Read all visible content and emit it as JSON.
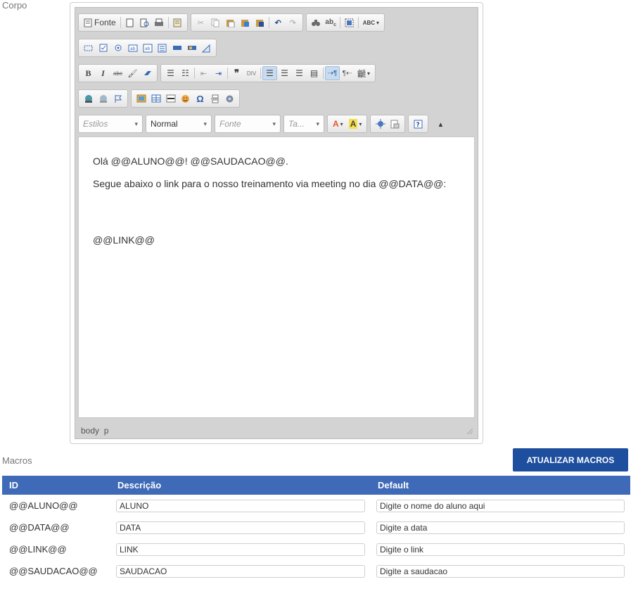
{
  "corpo_label": "Corpo",
  "toolbar": {
    "source_label": "Fonte",
    "spell_label": "ABC",
    "styles_placeholder": "Estilos",
    "format_value": "Normal",
    "font_placeholder": "Fonte",
    "size_placeholder": "Ta..."
  },
  "content": {
    "line1": "Olá @@ALUNO@@! @@SAUDACAO@@.",
    "line2": "Segue abaixo o link para o nosso treinamento via meeting no dia @@DATA@@:",
    "line3": "@@LINK@@"
  },
  "path": {
    "body": "body",
    "p": "p"
  },
  "macros_label": "Macros",
  "update_button": "ATUALIZAR MACROS",
  "table": {
    "headers": {
      "id": "ID",
      "descricao": "Descrição",
      "default": "Default"
    },
    "rows": [
      {
        "id": "@@ALUNO@@",
        "descricao": "ALUNO",
        "default": "Digite o nome do aluno aqui"
      },
      {
        "id": "@@DATA@@",
        "descricao": "DATA",
        "default": "Digite a data"
      },
      {
        "id": "@@LINK@@",
        "descricao": "LINK",
        "default": "Digite o link"
      },
      {
        "id": "@@SAUDACAO@@",
        "descricao": "SAUDACAO",
        "default": "Digite a saudacao"
      }
    ]
  },
  "colors": {
    "primary": "#1e4e9e",
    "table_header": "#3f6ab7"
  }
}
